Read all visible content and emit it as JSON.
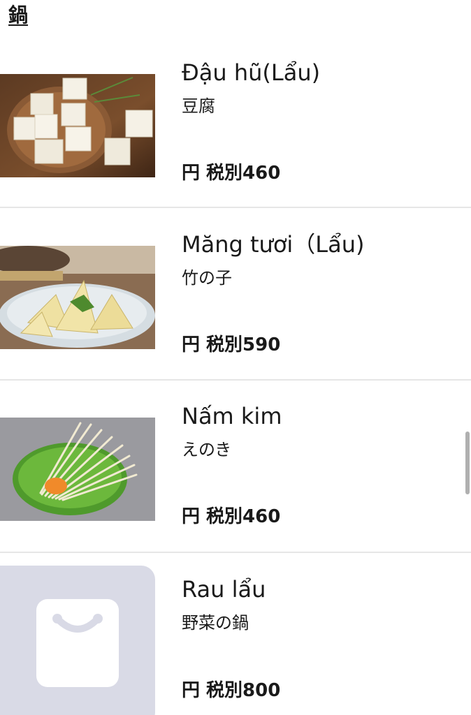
{
  "section": {
    "title": "鍋"
  },
  "items": [
    {
      "name": "Đậu hũ(Lẩu)",
      "sub": "豆腐",
      "price": "円 税別460",
      "image": "tofu-cubes-photo"
    },
    {
      "name": "Măng tươi（Lẩu)",
      "sub": "竹の子",
      "price": "円 税別590",
      "image": "bamboo-shoots-photo"
    },
    {
      "name": "Nấm kim",
      "sub": "えのき",
      "price": "円 税別460",
      "image": "enoki-mushroom-photo"
    },
    {
      "name": "Rau lẩu",
      "sub": "野菜の鍋",
      "price": "円 税別800",
      "image": "shopping-bag-icon"
    }
  ],
  "colors": {
    "placeholder_bg": "#d9dae6",
    "divider": "#e6e6e6",
    "text": "#1a1a1a"
  }
}
